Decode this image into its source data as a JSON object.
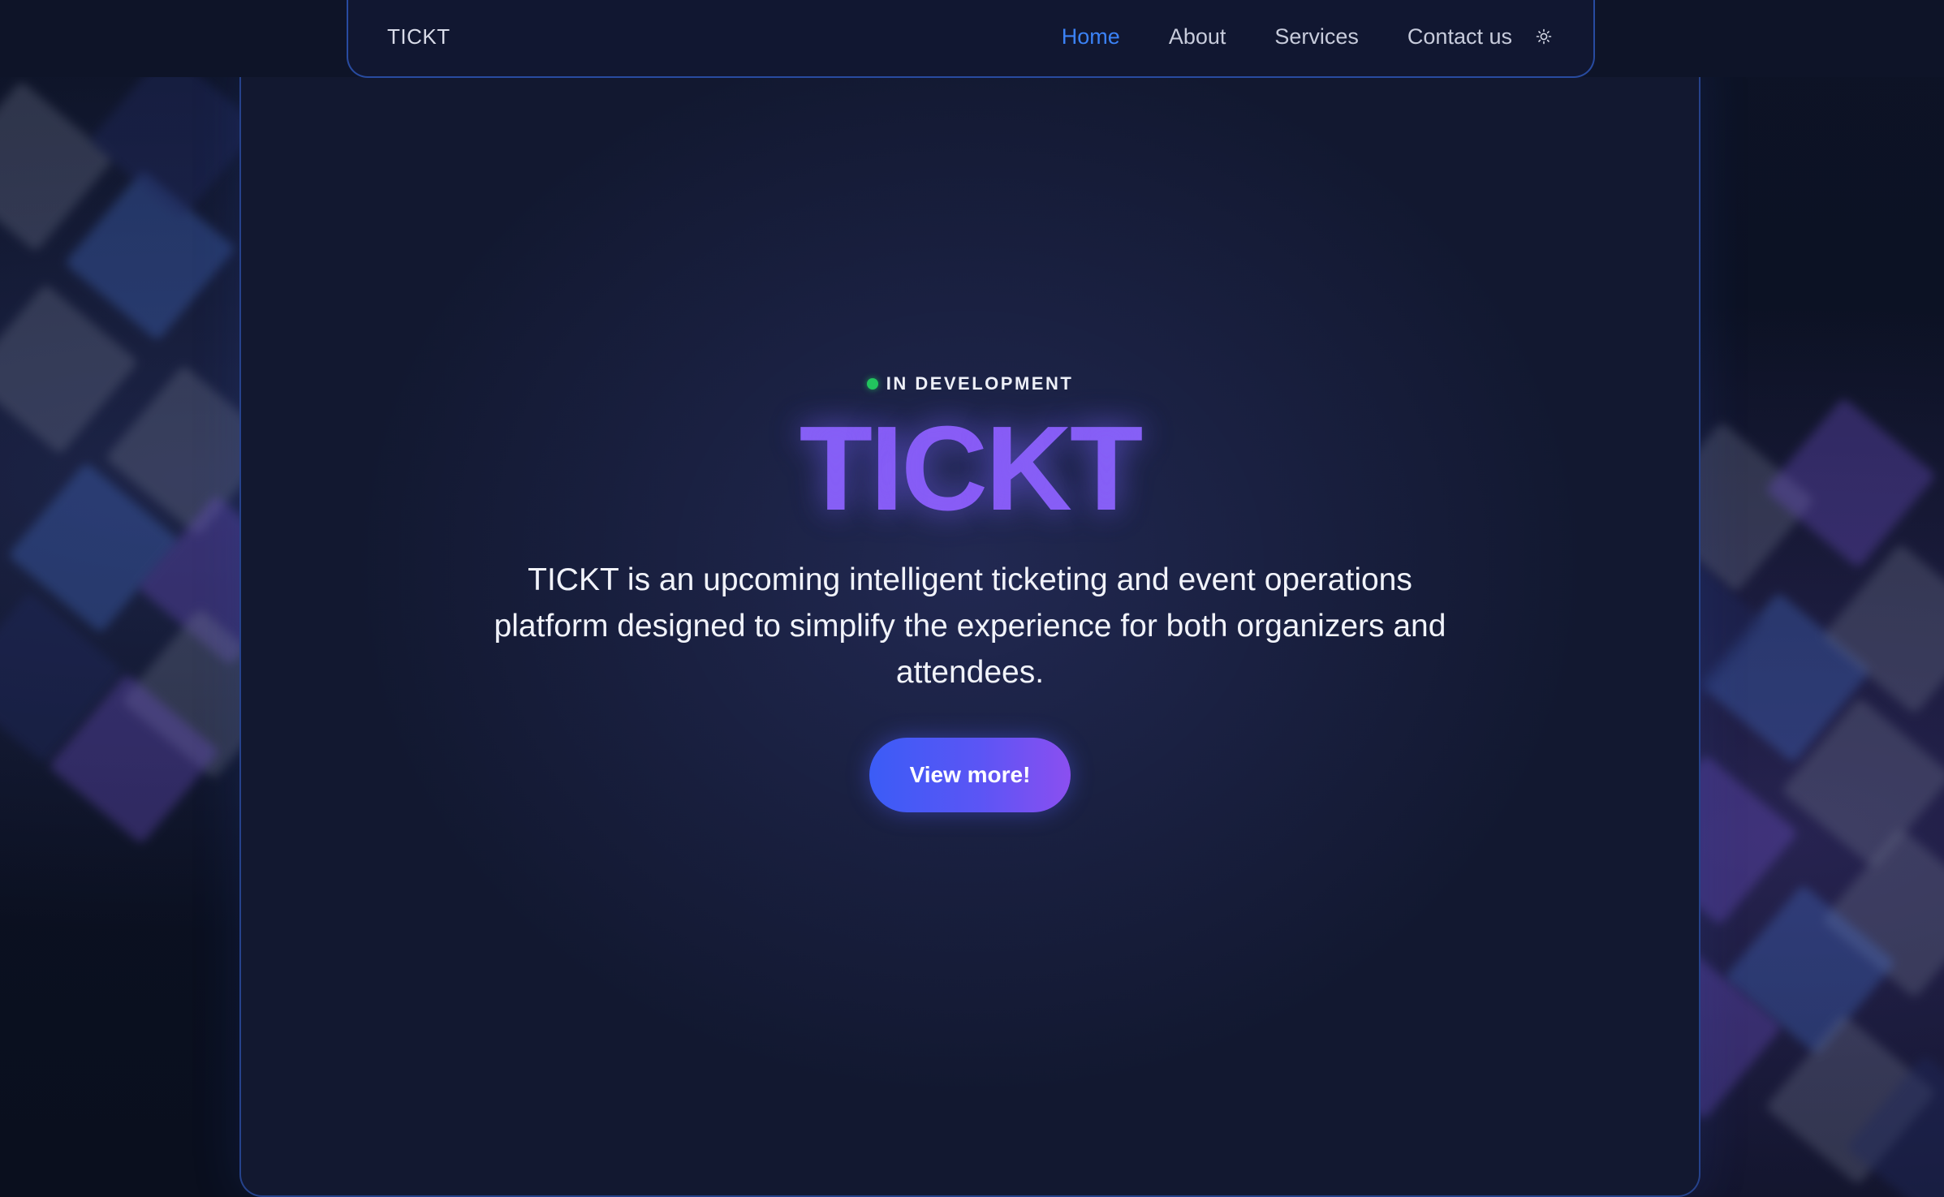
{
  "navbar": {
    "brand": "TICKT",
    "links": [
      {
        "label": "Home",
        "active": true
      },
      {
        "label": "About",
        "active": false
      },
      {
        "label": "Services",
        "active": false
      },
      {
        "label": "Contact us",
        "active": false
      }
    ],
    "theme_toggle_icon": "sun-icon"
  },
  "hero": {
    "status_label": "IN DEVELOPMENT",
    "status_color": "#22c55e",
    "title": "TICKT",
    "description": "TICKT is an upcoming intelligent ticketing and event operations platform designed to simplify the experience for both organizers and attendees.",
    "cta_label": "View more!"
  },
  "colors": {
    "accent": "#3b82f6",
    "title_gradient_start": "#7b6cf6",
    "title_gradient_end": "#8b5cf6",
    "cta_gradient_start": "#3b5cf6",
    "cta_gradient_end": "#8b4ff0",
    "background": "#0b1020"
  }
}
